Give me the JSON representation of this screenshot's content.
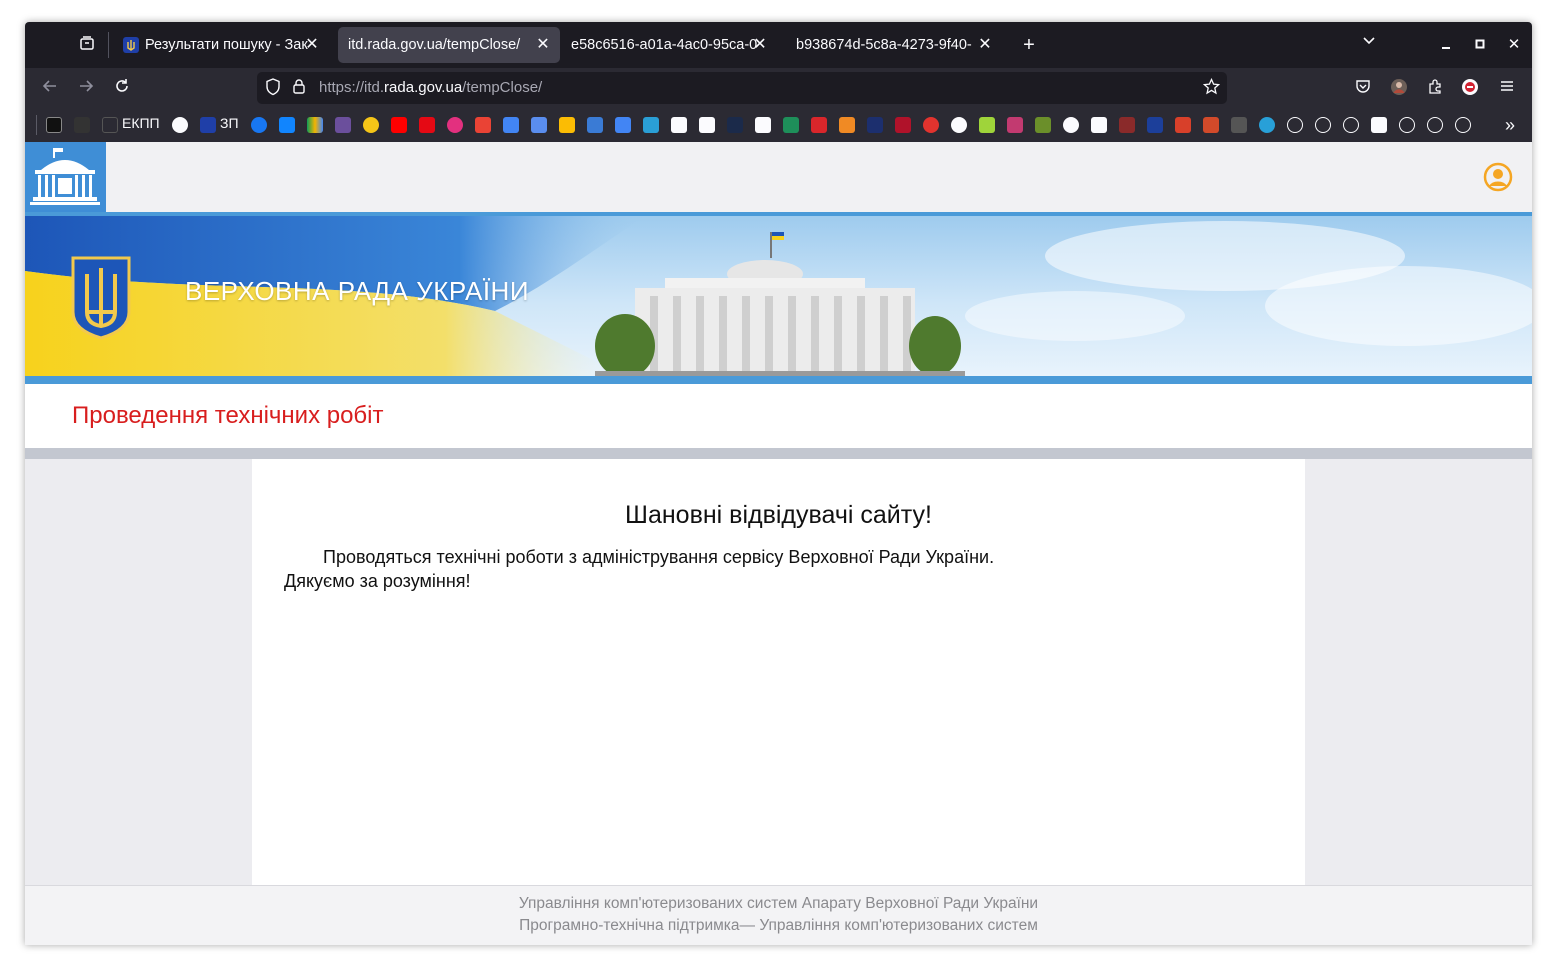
{
  "browser": {
    "tabs": [
      {
        "label": "Результати пошуку - Зак",
        "active": false
      },
      {
        "label": "itd.rada.gov.ua/tempClose/",
        "active": true
      },
      {
        "label": "e58c6516-a01a-4ac0-95ca-0",
        "active": false
      },
      {
        "label": "b938674d-5c8a-4273-9f40-",
        "active": false
      }
    ],
    "url": {
      "prefix": "https://itd.",
      "domain": "rada.gov.ua",
      "path": "/tempClose/"
    },
    "bookmarks_text": {
      "ekpp": "ЕКПП",
      "zp": "ЗП"
    }
  },
  "page": {
    "banner_title": "ВЕРХОВНА РАДА УКРАЇНИ",
    "maintenance_title": "Проведення технічних робіт",
    "content": {
      "heading": "Шановні відвідувачі сайту!",
      "paragraph1": "Проводяться технічні роботи з адміністрування сервісу Верховної Ради України.",
      "paragraph2": "Дякуємо за розуміння!"
    },
    "footer": {
      "line1": "Управління комп'ютеризованих систем Апарату Верховної Ради України",
      "line2": "Програмно-технічна підтримка— Управління комп'ютеризованих систем"
    }
  },
  "colors": {
    "maintenance_title": "#d81e1e",
    "banner_stripe": "#4a9ad8",
    "user_icon": "#f5a623"
  }
}
